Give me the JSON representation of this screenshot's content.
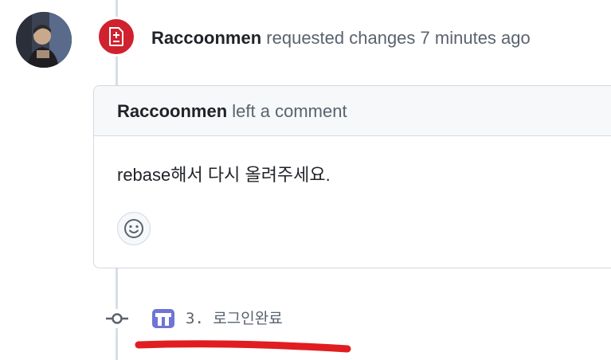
{
  "review": {
    "author": "Raccoonmen",
    "action": "requested changes",
    "time": "7 minutes ago"
  },
  "comment": {
    "author": "Raccoonmen",
    "action": "left a comment",
    "body": "rebase해서 다시 올려주세요."
  },
  "commit": {
    "message": "3. 로그인완료"
  },
  "colors": {
    "review_badge": "#cf222e",
    "underline": "#e11d21",
    "committer_avatar": "#6e74d8"
  },
  "icons": {
    "review_badge": "file-diff-icon",
    "reaction": "smiley-icon",
    "commit": "git-commit-icon"
  }
}
